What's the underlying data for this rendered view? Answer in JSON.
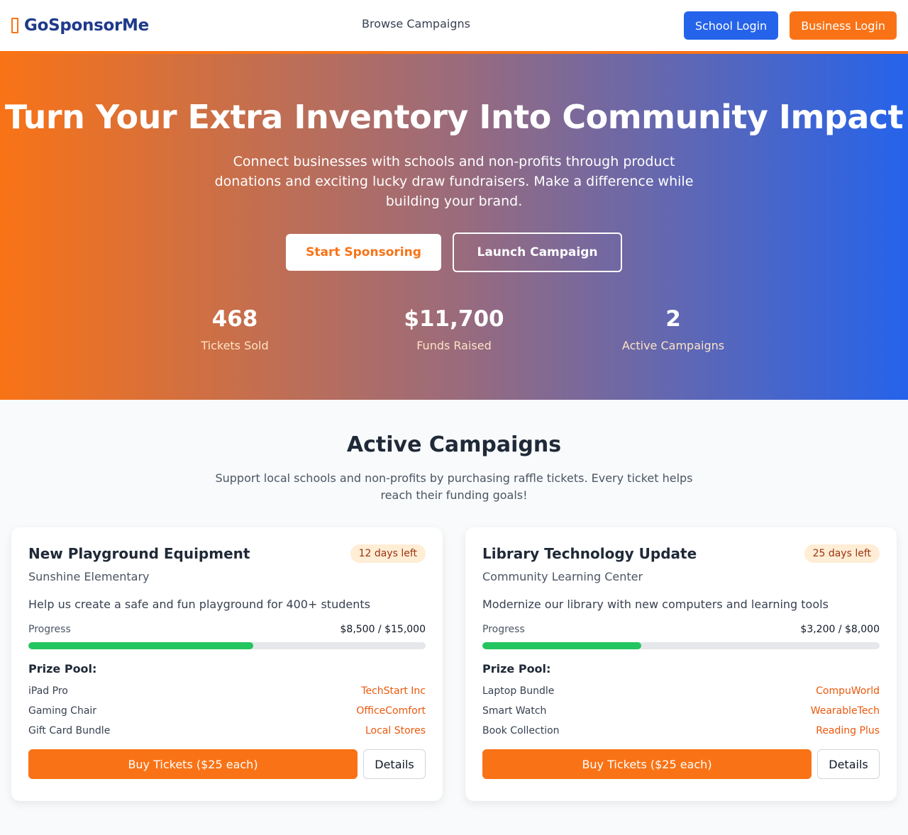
{
  "nav": {
    "brand_name": "GoSponsorMe",
    "brand_icon": "bookmark-outline-icon",
    "browse_link": "Browse Campaigns",
    "school_login": "School Login",
    "business_login": "Business Login"
  },
  "hero": {
    "title": "Turn Your Extra Inventory Into Community Impact",
    "subtitle": "Connect businesses with schools and non-profits through product donations and exciting lucky draw fundraisers. Make a difference while building your brand.",
    "start_button": "Start Sponsoring",
    "launch_button": "Launch Campaign",
    "stats": [
      {
        "value": "468",
        "label": "Tickets Sold"
      },
      {
        "value": "$11,700",
        "label": "Funds Raised"
      },
      {
        "value": "2",
        "label": "Active Campaigns"
      }
    ]
  },
  "campaigns_section": {
    "title": "Active Campaigns",
    "subtitle": "Support local schools and non-profits by purchasing raffle tickets. Every ticket helps reach their funding goals!"
  },
  "campaigns": [
    {
      "title": "New Playground Equipment",
      "days_left": "12 days left",
      "organization": "Sunshine Elementary",
      "description": "Help us create a safe and fun playground for 400+ students",
      "progress_label": "Progress",
      "progress_amount": "$8,500 / $15,000",
      "progress_fraction": 0.5667,
      "prize_heading": "Prize Pool:",
      "prizes": [
        {
          "name": "iPad Pro",
          "sponsor": "TechStart Inc"
        },
        {
          "name": "Gaming Chair",
          "sponsor": "OfficeComfort"
        },
        {
          "name": "Gift Card Bundle",
          "sponsor": "Local Stores"
        }
      ],
      "buy_button": "Buy Tickets ($25 each)",
      "details_button": "Details"
    },
    {
      "title": "Library Technology Update",
      "days_left": "25 days left",
      "organization": "Community Learning Center",
      "description": "Modernize our library with new computers and learning tools",
      "progress_label": "Progress",
      "progress_amount": "$3,200 / $8,000",
      "progress_fraction": 0.4,
      "prize_heading": "Prize Pool:",
      "prizes": [
        {
          "name": "Laptop Bundle",
          "sponsor": "CompuWorld"
        },
        {
          "name": "Smart Watch",
          "sponsor": "WearableTech"
        },
        {
          "name": "Book Collection",
          "sponsor": "Reading Plus"
        }
      ],
      "buy_button": "Buy Tickets ($25 each)",
      "details_button": "Details"
    }
  ],
  "colors": {
    "brand_orange": "#f97316",
    "brand_blue": "#2563eb",
    "brand_navy": "#1e3a8a",
    "progress_green": "#22c55e"
  }
}
